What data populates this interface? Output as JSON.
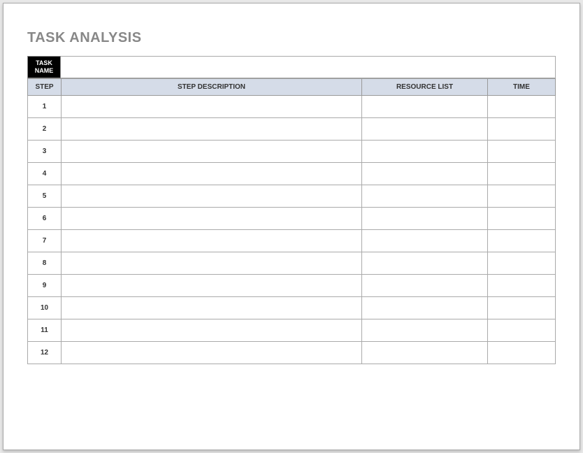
{
  "title": "TASK ANALYSIS",
  "taskNameLabel": "TASK NAME",
  "taskNameValue": "",
  "headers": {
    "step": "STEP",
    "description": "STEP DESCRIPTION",
    "resource": "RESOURCE LIST",
    "time": "TIME"
  },
  "rows": [
    {
      "step": "1",
      "description": "",
      "resource": "",
      "time": ""
    },
    {
      "step": "2",
      "description": "",
      "resource": "",
      "time": ""
    },
    {
      "step": "3",
      "description": "",
      "resource": "",
      "time": ""
    },
    {
      "step": "4",
      "description": "",
      "resource": "",
      "time": ""
    },
    {
      "step": "5",
      "description": "",
      "resource": "",
      "time": ""
    },
    {
      "step": "6",
      "description": "",
      "resource": "",
      "time": ""
    },
    {
      "step": "7",
      "description": "",
      "resource": "",
      "time": ""
    },
    {
      "step": "8",
      "description": "",
      "resource": "",
      "time": ""
    },
    {
      "step": "9",
      "description": "",
      "resource": "",
      "time": ""
    },
    {
      "step": "10",
      "description": "",
      "resource": "",
      "time": ""
    },
    {
      "step": "11",
      "description": "",
      "resource": "",
      "time": ""
    },
    {
      "step": "12",
      "description": "",
      "resource": "",
      "time": ""
    }
  ]
}
